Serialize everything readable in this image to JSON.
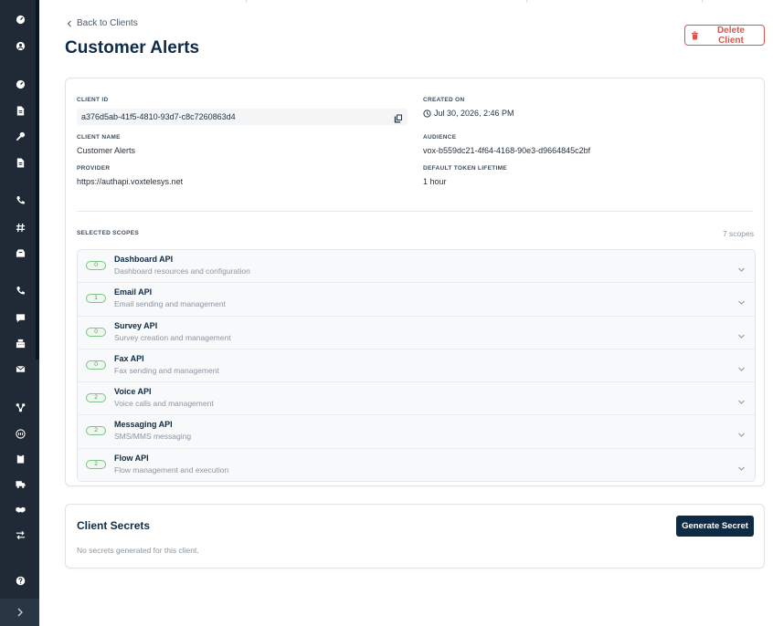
{
  "sidebar": {
    "icons": [
      {
        "name": "dashboard-icon",
        "glyph": "gauge"
      },
      {
        "name": "account-icon",
        "glyph": "person"
      },
      {
        "name": "speed-icon",
        "glyph": "gauge"
      },
      {
        "name": "document-icon",
        "glyph": "doc"
      },
      {
        "name": "key-icon",
        "glyph": "key"
      },
      {
        "name": "file-icon",
        "glyph": "doc"
      },
      {
        "name": "phone-icon",
        "glyph": "phone"
      },
      {
        "name": "hash-icon",
        "glyph": "hash"
      },
      {
        "name": "inbox-icon",
        "glyph": "tray"
      },
      {
        "name": "voice-icon",
        "glyph": "phone"
      },
      {
        "name": "chat-icon",
        "glyph": "chat"
      },
      {
        "name": "fax-icon",
        "glyph": "fax"
      },
      {
        "name": "email-icon",
        "glyph": "mail"
      },
      {
        "name": "flow-icon",
        "glyph": "flow"
      },
      {
        "name": "integration-icon",
        "glyph": "circle"
      },
      {
        "name": "clipboard-icon",
        "glyph": "clip"
      },
      {
        "name": "delivery-icon",
        "glyph": "truck"
      },
      {
        "name": "partner-icon",
        "glyph": "hands"
      },
      {
        "name": "transfer-icon",
        "glyph": "swap"
      },
      {
        "name": "help-icon",
        "glyph": "question"
      }
    ],
    "expand_label": "›"
  },
  "header": {
    "back_label": "Back to Clients",
    "title": "Customer Alerts",
    "delete_label": "Delete Client"
  },
  "details": {
    "client_id_label": "CLIENT ID",
    "client_id": "a376d5ab-41f5-4810-93d7-c8c7260863d4",
    "created_on_label": "CREATED ON",
    "created_on": "Jul 30, 2026, 2:46 PM",
    "client_name_label": "CLIENT NAME",
    "client_name": "Customer Alerts",
    "audience_label": "AUDIENCE",
    "audience": "vox-b559dc21-4f64-4168-90e3-d9664845c2bf",
    "provider_label": "PROVIDER",
    "provider": "https://authapi.voxtelesys.net",
    "token_lifetime_label": "DEFAULT TOKEN LIFETIME",
    "token_lifetime": "1 hour"
  },
  "scopes": {
    "label": "SELECTED SCOPES",
    "count_text": "7 scopes",
    "items": [
      {
        "count": "0",
        "name": "Dashboard API",
        "description": "Dashboard resources and configuration"
      },
      {
        "count": "1",
        "name": "Email API",
        "description": "Email sending and management"
      },
      {
        "count": "0",
        "name": "Survey API",
        "description": "Survey creation and management"
      },
      {
        "count": "0",
        "name": "Fax API",
        "description": "Fax sending and management"
      },
      {
        "count": "2",
        "name": "Voice API",
        "description": "Voice calls and management"
      },
      {
        "count": "2",
        "name": "Messaging API",
        "description": "SMS/MMS messaging"
      },
      {
        "count": "2",
        "name": "Flow API",
        "description": "Flow management and execution"
      }
    ]
  },
  "secrets": {
    "title": "Client Secrets",
    "generate_label": "Generate Secret",
    "empty_text": "No secrets generated for this client."
  },
  "colors": {
    "rail": "#1f2a36",
    "primary": "#0f2a44",
    "danger": "#d9534f",
    "scope_badge": "#7fc28a"
  }
}
